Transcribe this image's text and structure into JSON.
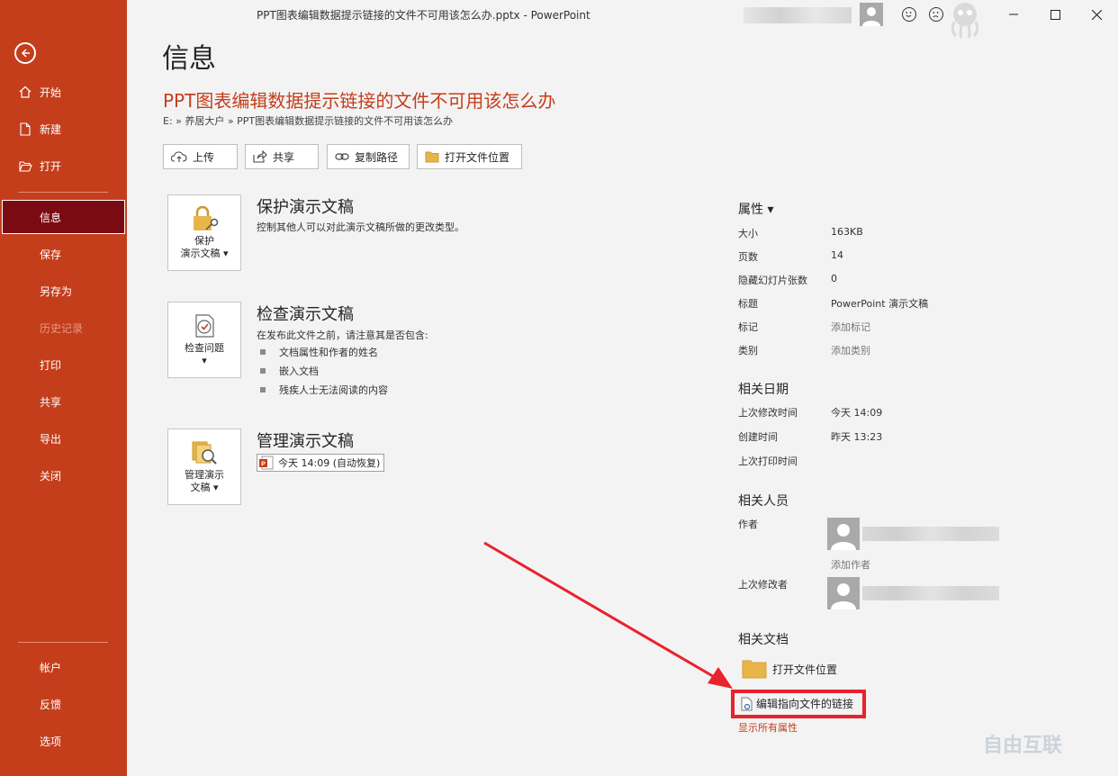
{
  "window": {
    "title": "PPT图表编辑数据提示链接的文件不可用该怎么办.pptx  -  PowerPoint"
  },
  "sidebar": {
    "items": [
      {
        "label": "开始",
        "icon": "home-icon"
      },
      {
        "label": "新建",
        "icon": "new-file-icon"
      },
      {
        "label": "打开",
        "icon": "open-folder-icon"
      },
      {
        "label": "信息"
      },
      {
        "label": "保存"
      },
      {
        "label": "另存为"
      },
      {
        "label": "历史记录"
      },
      {
        "label": "打印"
      },
      {
        "label": "共享"
      },
      {
        "label": "导出"
      },
      {
        "label": "关闭"
      },
      {
        "label": "帐户"
      },
      {
        "label": "反馈"
      },
      {
        "label": "选项"
      }
    ]
  },
  "main": {
    "page_title": "信息",
    "doc_title": "PPT图表编辑数据提示链接的文件不可用该怎么办",
    "doc_path": "E: » 养居大户 » PPT图表编辑数据提示链接的文件不可用该怎么办",
    "actions": {
      "upload": "上传",
      "share": "共享",
      "copy_path": "复制路径",
      "open_location": "打开文件位置"
    },
    "protect": {
      "button_line1": "保护",
      "button_line2": "演示文稿 ▾",
      "title": "保护演示文稿",
      "desc": "控制其他人可以对此演示文稿所做的更改类型。"
    },
    "inspect": {
      "button_line1": "检查问题",
      "button_line2": "▾",
      "title": "检查演示文稿",
      "desc": "在发布此文件之前，请注意其是否包含:",
      "bullets": [
        "文档属性和作者的姓名",
        "嵌入文档",
        "残疾人士无法阅读的内容"
      ]
    },
    "manage": {
      "button_line1": "管理演示",
      "button_line2": "文稿 ▾",
      "title": "管理演示文稿",
      "version": "今天 14:09 (自动恢复)"
    }
  },
  "properties": {
    "header": "属性 ▾",
    "rows": [
      {
        "label": "大小",
        "value": "163KB"
      },
      {
        "label": "页数",
        "value": "14"
      },
      {
        "label": "隐藏幻灯片张数",
        "value": "0"
      },
      {
        "label": "标题",
        "value": "PowerPoint 演示文稿"
      },
      {
        "label": "标记",
        "value": "添加标记"
      },
      {
        "label": "类别",
        "value": "添加类别"
      }
    ],
    "dates_header": "相关日期",
    "dates": [
      {
        "label": "上次修改时间",
        "value": "今天 14:09"
      },
      {
        "label": "创建时间",
        "value": "昨天 13:23"
      },
      {
        "label": "上次打印时间",
        "value": ""
      }
    ],
    "people_header": "相关人员",
    "author_label": "作者",
    "add_author": "添加作者",
    "last_modified_by_label": "上次修改者",
    "docs_header": "相关文档",
    "open_location": "打开文件位置",
    "edit_links": "编辑指向文件的链接",
    "show_all": "显示所有属性"
  },
  "watermark": "自由互联",
  "colors": {
    "accent": "#c43e1c",
    "sidebar_active": "#7b0b12",
    "highlight": "#e8232c"
  }
}
